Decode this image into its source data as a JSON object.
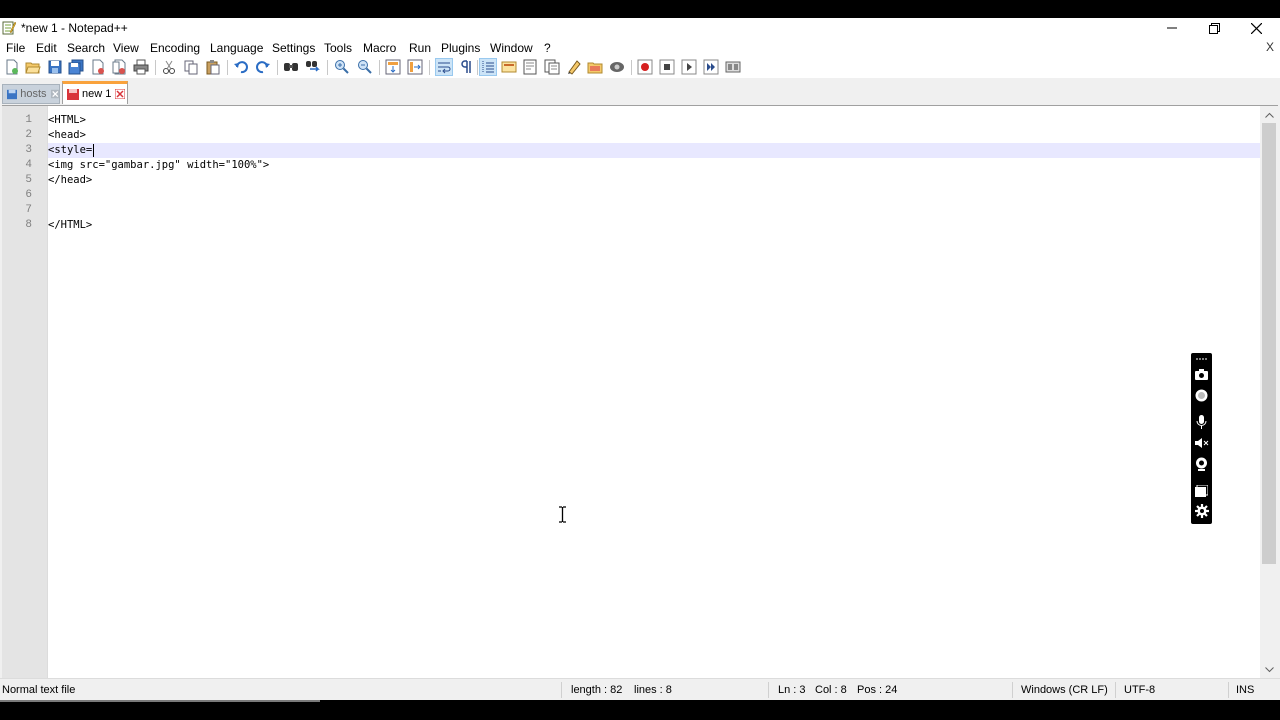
{
  "window": {
    "title": "*new 1 - Notepad++",
    "doc_close_label": "X"
  },
  "menu": [
    "File",
    "Edit",
    "Search",
    "View",
    "Encoding",
    "Language",
    "Settings",
    "Tools",
    "Macro",
    "Run",
    "Plugins",
    "Window",
    "?"
  ],
  "toolbar_icons": [
    "new-file-icon",
    "open-file-icon",
    "save-icon",
    "save-all-icon",
    "close-icon",
    "close-all-icon",
    "print-icon",
    "cut-icon",
    "copy-icon",
    "paste-icon",
    "undo-icon",
    "redo-icon",
    "find-icon",
    "replace-icon",
    "zoom-in-icon",
    "zoom-out-icon",
    "sync-vertical-icon",
    "sync-horizontal-icon",
    "word-wrap-icon",
    "show-all-chars-icon",
    "indent-guide-icon",
    "udl-icon",
    "doc-map-icon",
    "function-list-icon",
    "folder-workspace-icon",
    "monitoring-icon",
    "record-macro-icon",
    "stop-record-icon",
    "play-macro-icon",
    "run-macro-multiple-icon",
    "save-macro-icon"
  ],
  "tabs": [
    {
      "label": "hosts",
      "active": false
    },
    {
      "label": "new 1",
      "active": true
    }
  ],
  "editor": {
    "lines": [
      "<HTML>",
      "<head>",
      "<style=",
      "<img src=\"gambar.jpg\" width=\"100%\">",
      "</head>",
      "",
      "",
      "</HTML>"
    ],
    "line_numbers": [
      "1",
      "2",
      "3",
      "4",
      "5",
      "6",
      "7",
      "8"
    ],
    "current_line": 3,
    "vertical_scroll_fraction": 0.0
  },
  "status": {
    "file_type": "Normal text file",
    "length": "length : 82",
    "lines": "lines : 8",
    "ln": "Ln : 3",
    "col": "Col : 8",
    "pos": "Pos : 24",
    "eol": "Windows (CR LF)",
    "encoding": "UTF-8",
    "mode": "INS"
  },
  "colors": {
    "current_line_bg": "#e8e8ff",
    "active_tab_accent": "#f9a23c",
    "gutter_bg": "#e4e4e4"
  },
  "recorder_icons": [
    "camera-icon",
    "record-icon",
    "microphone-icon",
    "speaker-icon",
    "webcam-icon",
    "window-icon",
    "settings-icon"
  ]
}
